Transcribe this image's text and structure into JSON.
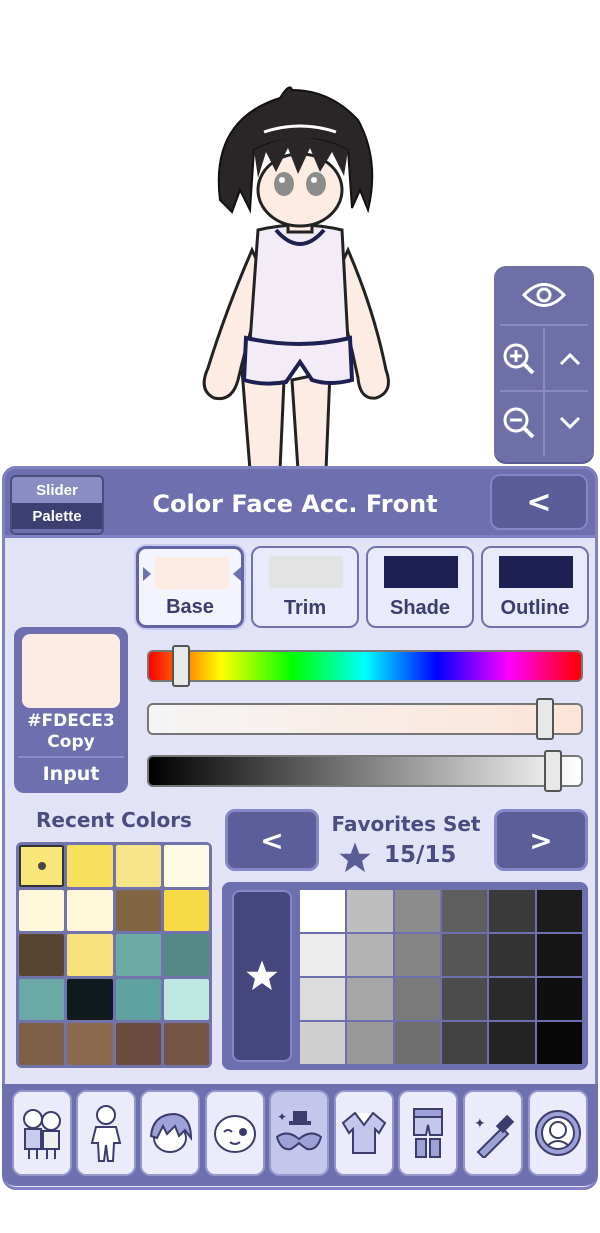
{
  "header": {
    "mode_slider": "Slider",
    "mode_palette": "Palette",
    "title": "Color Face Acc. Front",
    "back_label": "<"
  },
  "view_controls": [
    "eye-icon",
    "zoom-in-icon",
    "zoom-out-icon",
    "scroll-up-icon",
    "scroll-down-icon"
  ],
  "color_slots": [
    {
      "label": "Base",
      "color": "#FDECE3",
      "active": true
    },
    {
      "label": "Trim",
      "color": "#E3E3E3",
      "active": false
    },
    {
      "label": "Shade",
      "color": "#1E1F52",
      "active": false
    },
    {
      "label": "Outline",
      "color": "#1E1F52",
      "active": false
    }
  ],
  "current": {
    "hex": "#FDECE3",
    "copy_label": "Copy",
    "input_label": "Input"
  },
  "sliders": {
    "hue_position": 0.06,
    "saturation_position": 0.93,
    "value_position": 0.95
  },
  "recent": {
    "title": "Recent Colors",
    "colors": [
      "#F8E678",
      "#F6E05C",
      "#F7E58A",
      "#FEFBE4",
      "#FEF9DA",
      "#FEF7D8",
      "#826542",
      "#F8DA46",
      "#584530",
      "#F5E27A",
      "#6EAAA4",
      "#548986",
      "#6BA9A7",
      "#111A1C",
      "#60A2A2",
      "#BEE7E1",
      "#7E6048",
      "#8B6A50",
      "#6A4C3E",
      "#755543"
    ]
  },
  "favorites": {
    "title": "Favorites Set",
    "count": "15/15",
    "prev_label": "<",
    "next_label": ">",
    "colors": [
      "#FFFFFF",
      "#BEBEBE",
      "#8C8C8C",
      "#5E5E5E",
      "#3A3A3A",
      "#1C1C1C",
      "#ECECEC",
      "#B3B3B3",
      "#858585",
      "#565656",
      "#333333",
      "#161616",
      "#DCDCDC",
      "#A6A6A6",
      "#7A7A7A",
      "#4C4C4C",
      "#2A2A2A",
      "#0F0F0F",
      "#CFCFCF",
      "#999999",
      "#6E6E6E",
      "#434343",
      "#232323",
      "#080808"
    ]
  },
  "toolbar": [
    "presets-icon",
    "body-icon",
    "hair-icon",
    "face-icon",
    "accessories-icon",
    "top-icon",
    "bottom-icon",
    "props-icon",
    "profile-icon"
  ]
}
